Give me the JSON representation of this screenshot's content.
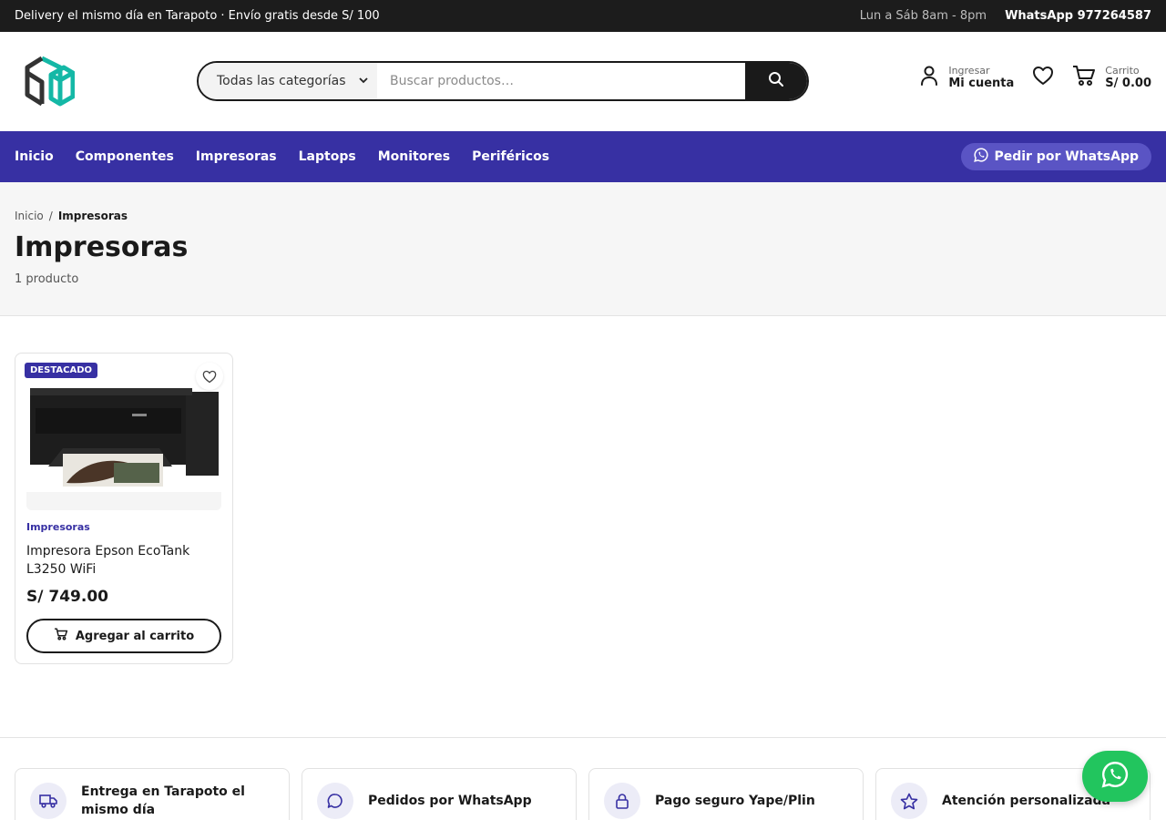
{
  "topbar": {
    "promo": "Delivery el mismo día en Tarapoto · Envío gratis desde S/ 100",
    "hours": "Lun a Sáb 8am - 8pm",
    "whatsapp": "WhatsApp 977264587"
  },
  "header": {
    "logo_icon": "cube-logo-icon",
    "search": {
      "category": "Todas las categorías",
      "placeholder": "Buscar productos…"
    },
    "account": {
      "top": "Ingresar",
      "label": "Mi cuenta"
    },
    "cart": {
      "top": "Carrito",
      "total": "S/ 0.00"
    }
  },
  "nav": {
    "items": [
      "Inicio",
      "Componentes",
      "Impresoras",
      "Laptops",
      "Monitores",
      "Periféricos"
    ],
    "whatsapp_button": "Pedir por WhatsApp"
  },
  "page": {
    "breadcrumb": [
      "Inicio",
      "Impresoras"
    ],
    "title": "Impresoras",
    "count": "1 producto"
  },
  "product": {
    "badge": "DESTACADO",
    "category": "Impresoras",
    "name": "Impresora Epson EcoTank L3250 WiFi",
    "price": "S/ 749.00",
    "add_button": "Agregar al carrito"
  },
  "features": [
    {
      "icon": "truck-icon",
      "text": "Entrega en Tarapoto el mismo día"
    },
    {
      "icon": "chat-icon",
      "text": "Pedidos por WhatsApp"
    },
    {
      "icon": "lock-icon",
      "text": "Pago seguro Yape/Plin"
    },
    {
      "icon": "star-icon",
      "text": "Atención personalizada"
    }
  ],
  "colors": {
    "brand": "#3730a3",
    "logo": "#14b8a6",
    "whatsapp": "#22c55e",
    "dark": "#1a1a1a"
  }
}
